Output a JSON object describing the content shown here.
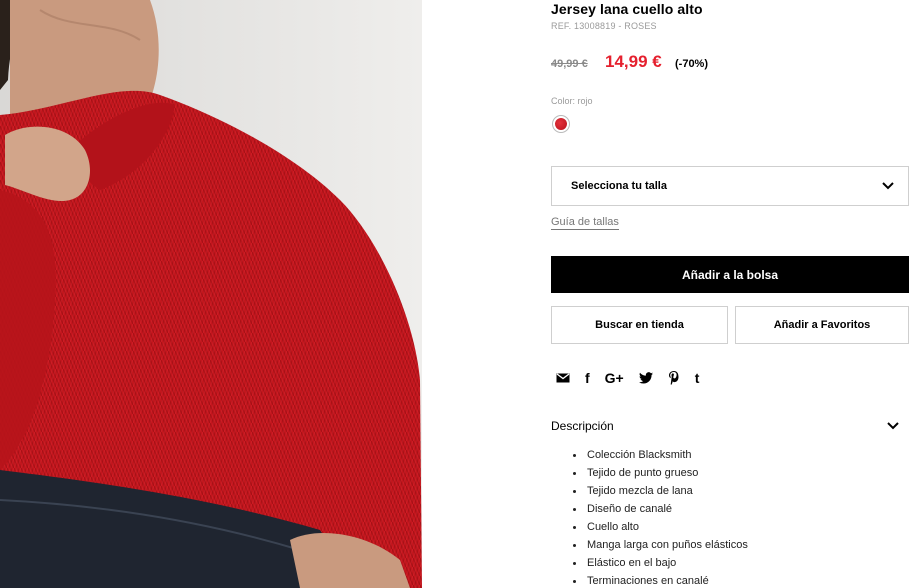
{
  "product": {
    "title": "Jersey lana cuello alto",
    "ref": "REF. 13008819 - ROSES",
    "old_price": "49,99 €",
    "new_price": "14,99 €",
    "discount": "(-70%)",
    "color_label": "Color: rojo",
    "swatch_color": "#c8141f"
  },
  "size_select": {
    "label": "Selecciona tu talla"
  },
  "size_guide": "Guía de tallas",
  "actions": {
    "add_to_bag": "Añadir a la bolsa",
    "find_in_store": "Buscar en tienda",
    "add_to_favorites": "Añadir a Favoritos"
  },
  "share": {
    "icons": [
      "email-icon",
      "facebook-icon",
      "google-plus-icon",
      "twitter-icon",
      "pinterest-icon",
      "tumblr-icon"
    ],
    "google_plus_glyph": "G+",
    "facebook_glyph": "f",
    "tumblr_glyph": "t"
  },
  "description": {
    "label": "Descripción",
    "items": [
      "Colección Blacksmith",
      "Tejido de punto grueso",
      "Tejido mezcla de lana",
      "Diseño de canalé",
      "Cuello alto",
      "Manga larga con puños elásticos",
      "Elástico en el bajo",
      "Terminaciones en canalé"
    ]
  },
  "colors": {
    "accent_red": "#e5202e",
    "button_black": "#000000"
  }
}
